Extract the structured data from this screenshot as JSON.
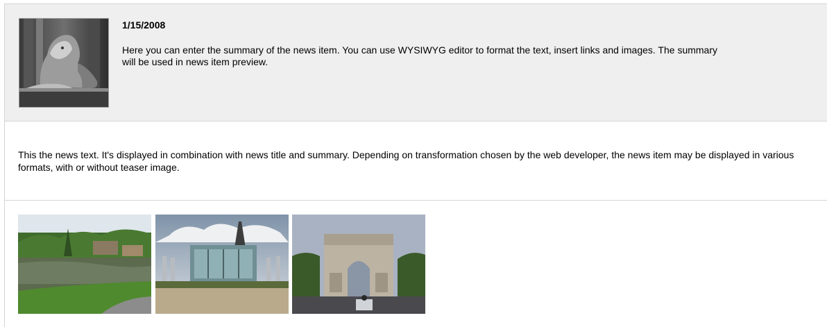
{
  "news_item": {
    "date": "1/15/2008",
    "summary": "Here you can enter the summary of the news item. You can use WYSIWYG editor to format the text, insert links and images. The summary will be used in news item preview.",
    "text": "This the news text. It's displayed in combination with news title and summary. Depending on transformation chosen by the web developer, the news item may be displayed in various formats, with or without teaser image.",
    "teaser_image": "lion-statue-photo",
    "gallery": [
      {
        "image": "pond-landscape-photo"
      },
      {
        "image": "glass-building-eiffel-tower-photo"
      },
      {
        "image": "arc-de-triomphe-photo"
      }
    ]
  },
  "colors": {
    "summary_background": "#efefef",
    "border": "#d4d4d4"
  }
}
